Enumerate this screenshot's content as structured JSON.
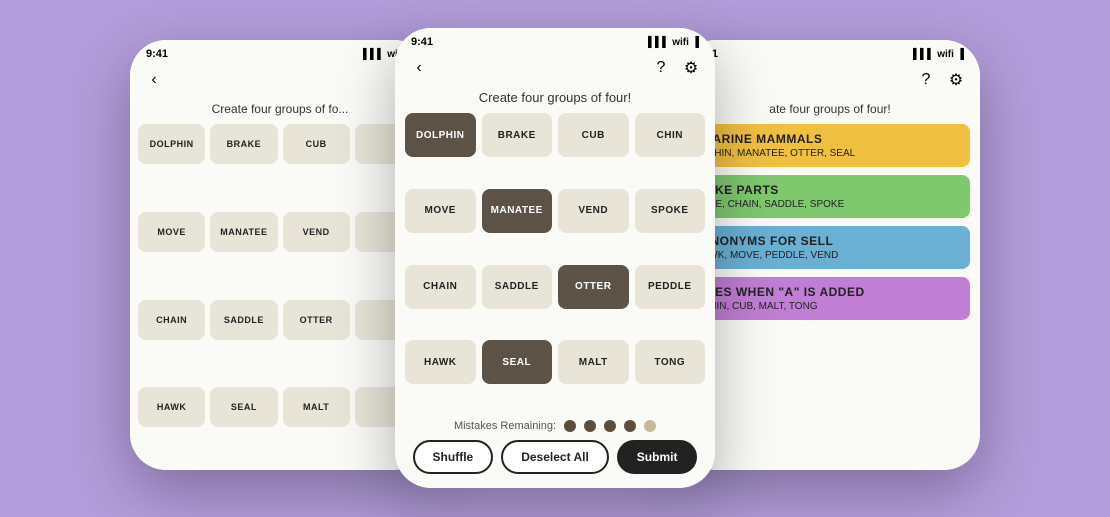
{
  "background": "#b39ddb",
  "phones": {
    "left": {
      "statusBar": {
        "time": "9:41"
      },
      "title": "Create four groups of fo...",
      "grid": [
        [
          "DOLPHIN",
          "BRAKE",
          "CUB",
          ""
        ],
        [
          "MOVE",
          "MANATEE",
          "VEND",
          ""
        ],
        [
          "CHAIN",
          "SADDLE",
          "OTTER",
          ""
        ],
        [
          "HAWK",
          "SEAL",
          "MALT",
          ""
        ]
      ]
    },
    "center": {
      "statusBar": {
        "time": "9:41"
      },
      "title": "Create four groups of four!",
      "grid": [
        [
          {
            "word": "DOLPHIN",
            "selected": true
          },
          {
            "word": "BRAKE",
            "selected": false
          },
          {
            "word": "CUB",
            "selected": false
          },
          {
            "word": "CHIN",
            "selected": false
          }
        ],
        [
          {
            "word": "MOVE",
            "selected": false
          },
          {
            "word": "MANATEE",
            "selected": true
          },
          {
            "word": "VEND",
            "selected": false
          },
          {
            "word": "SPOKE",
            "selected": false
          }
        ],
        [
          {
            "word": "CHAIN",
            "selected": false
          },
          {
            "word": "SADDLE",
            "selected": false
          },
          {
            "word": "OTTER",
            "selected": true
          },
          {
            "word": "PEDDLE",
            "selected": false
          }
        ],
        [
          {
            "word": "HAWK",
            "selected": false
          },
          {
            "word": "SEAL",
            "selected": true
          },
          {
            "word": "MALT",
            "selected": false
          },
          {
            "word": "TONG",
            "selected": false
          }
        ]
      ],
      "mistakes": {
        "label": "Mistakes Remaining:",
        "dots": [
          {
            "color": "#7a6a5a"
          },
          {
            "color": "#7a6a5a"
          },
          {
            "color": "#7a6a5a"
          },
          {
            "color": "#7a6a5a"
          },
          {
            "color": "#c8b89a"
          }
        ]
      },
      "buttons": {
        "shuffle": "Shuffle",
        "deselectAll": "Deselect All",
        "submit": "Submit"
      }
    },
    "right": {
      "statusBar": {
        "time": "9:41"
      },
      "title": "ate four groups of four!",
      "cards": [
        {
          "color": "card-yellow",
          "title": "MARINE MAMMALS",
          "words": "LPHIN, MANATEE, OTTER, SEAL"
        },
        {
          "color": "card-green",
          "title": "BIKE PARTS",
          "words": "AKE, CHAIN, SADDLE, SPOKE"
        },
        {
          "color": "card-blue",
          "title": "YNONYMS FOR SELL",
          "words": "AWK, MOVE, PEDDLE, VEND"
        },
        {
          "color": "card-purple",
          "title": "RIES WHEN \"A\" IS ADDED",
          "words": "CHIN, CUB, MALT, TONG"
        }
      ]
    }
  }
}
